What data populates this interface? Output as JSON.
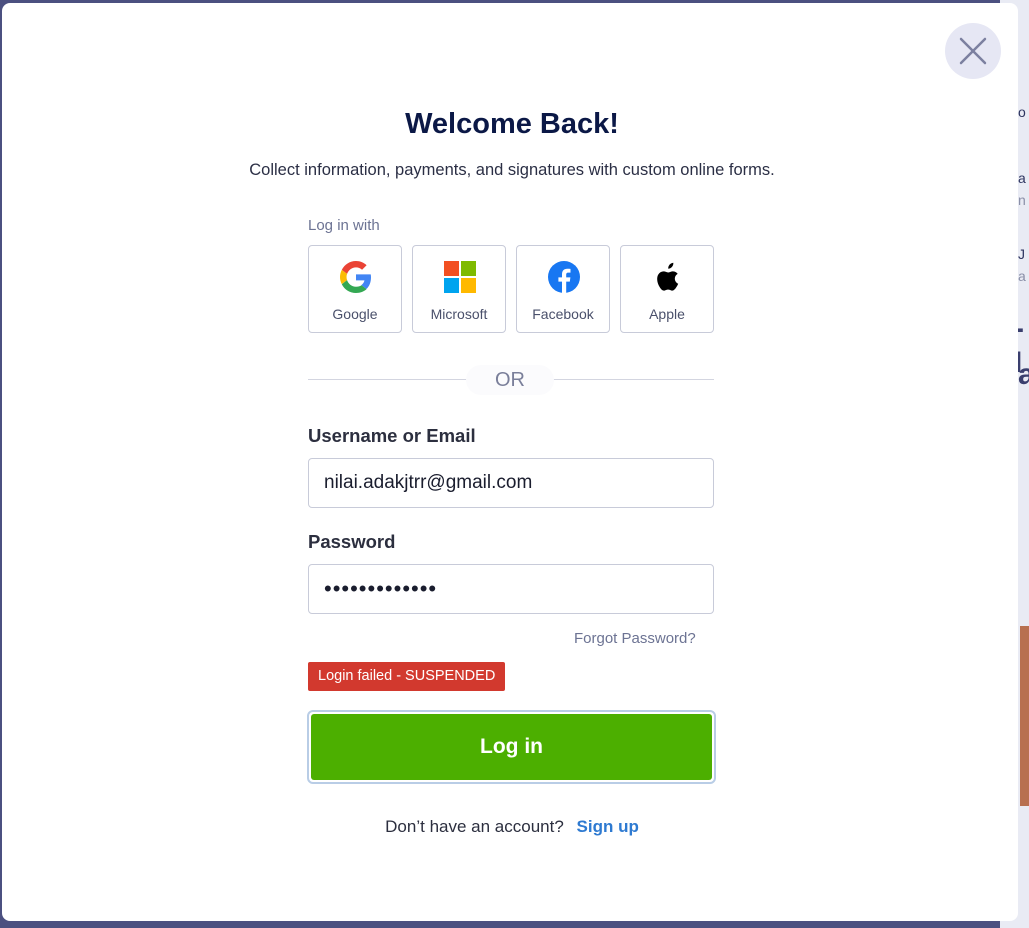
{
  "background": {
    "fragments": [
      "o",
      "a",
      "n",
      "J",
      "a",
      "-I",
      "a"
    ]
  },
  "modal": {
    "title": "Welcome Back!",
    "subtitle": "Collect information, payments, and signatures with custom online forms.",
    "close_icon": "close-icon"
  },
  "social": {
    "heading": "Log in with",
    "providers": [
      {
        "label": "Google",
        "icon": "google-icon"
      },
      {
        "label": "Microsoft",
        "icon": "microsoft-icon"
      },
      {
        "label": "Facebook",
        "icon": "facebook-icon"
      },
      {
        "label": "Apple",
        "icon": "apple-icon"
      }
    ]
  },
  "divider": {
    "label": "OR"
  },
  "form": {
    "username_label": "Username or Email",
    "username_value": "nilai.adakjtrr@gmail.com",
    "password_label": "Password",
    "password_value": "•••••••••••••",
    "forgot_label": "Forgot Password?",
    "error_message": "Login failed - SUSPENDED",
    "submit_label": "Log in"
  },
  "signup": {
    "question": "Don’t have an account?",
    "link_label": "Sign up"
  },
  "colors": {
    "primary_button": "#4caf00",
    "error": "#d2392e",
    "title": "#0b1846",
    "link": "#2e7ad1"
  }
}
